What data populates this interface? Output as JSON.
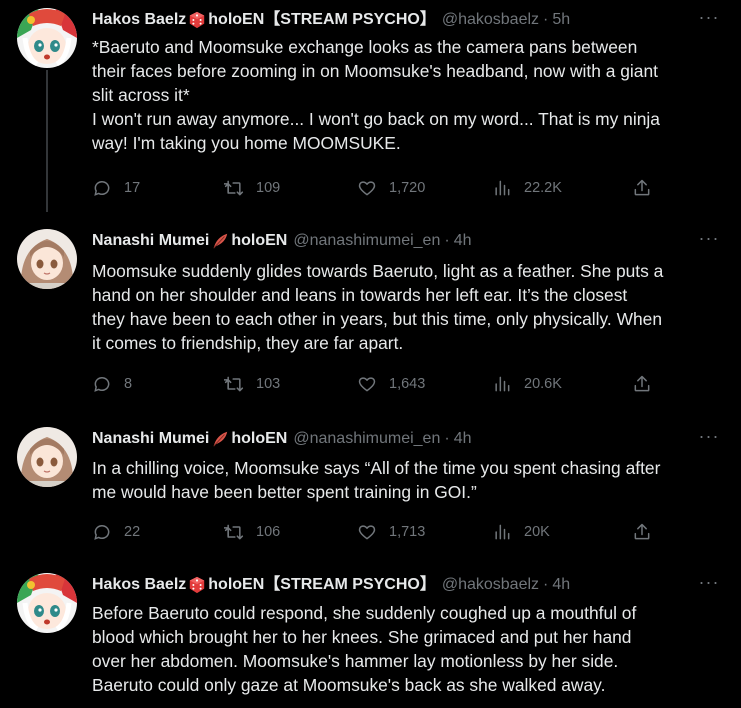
{
  "tweets": [
    {
      "author": "Hakos Baelz",
      "suffix": "holoEN",
      "tag": "【STREAM PSYCHO】",
      "handle": "@hakosbaelz",
      "time": "5h",
      "text": "*Baeruto and Moomsuke exchange looks as the camera pans between\ntheir faces before zooming in on Moomsuke's headband, now with a giant\nslit across it*\nI won't run away anymore... I won't go back on my word... That is my ninja\nway! I'm taking you home MOOMSUKE.",
      "replies": "17",
      "retweets": "109",
      "likes": "1,720",
      "views": "22.2K"
    },
    {
      "author": "Nanashi Mumei",
      "suffix": "holoEN",
      "tag": "",
      "handle": "@nanashimumei_en",
      "time": "4h",
      "text": "Moomsuke suddenly glides towards Baeruto, light as a feather. She puts a\nhand on her shoulder and leans in towards her left ear. It’s the closest\nthey have been to each other in years, but this time, only physically. When\nit comes to friendship, they are far apart.",
      "replies": "8",
      "retweets": "103",
      "likes": "1,643",
      "views": "20.6K"
    },
    {
      "author": "Nanashi Mumei",
      "suffix": "holoEN",
      "tag": "",
      "handle": "@nanashimumei_en",
      "time": "4h",
      "text": "In a chilling voice, Moomsuke says “All of the time you spent chasing after\nme would have been better spent training in GOI.”",
      "replies": "22",
      "retweets": "106",
      "likes": "1,713",
      "views": "20K"
    },
    {
      "author": "Hakos Baelz",
      "suffix": "holoEN",
      "tag": "【STREAM PSYCHO】",
      "handle": "@hakosbaelz",
      "time": "4h",
      "text": "Before Baeruto could respond, she suddenly coughed up a mouthful of\nblood which brought her to her knees. She grimaced and put her hand\nover her abdomen. Moomsuke's hammer lay motionless by her side.\nBaeruto could only gaze at Moomsuke's back as she walked away."
    }
  ],
  "separator": "·",
  "more_label": "···",
  "colors": {
    "background": "#000000",
    "text": "#e7e9ea",
    "muted": "#71767b",
    "thread_line": "#333639"
  },
  "icons": [
    "die-emoji",
    "feather-emoji",
    "reply-icon",
    "retweet-icon",
    "like-icon",
    "views-icon",
    "share-icon",
    "more-icon"
  ]
}
